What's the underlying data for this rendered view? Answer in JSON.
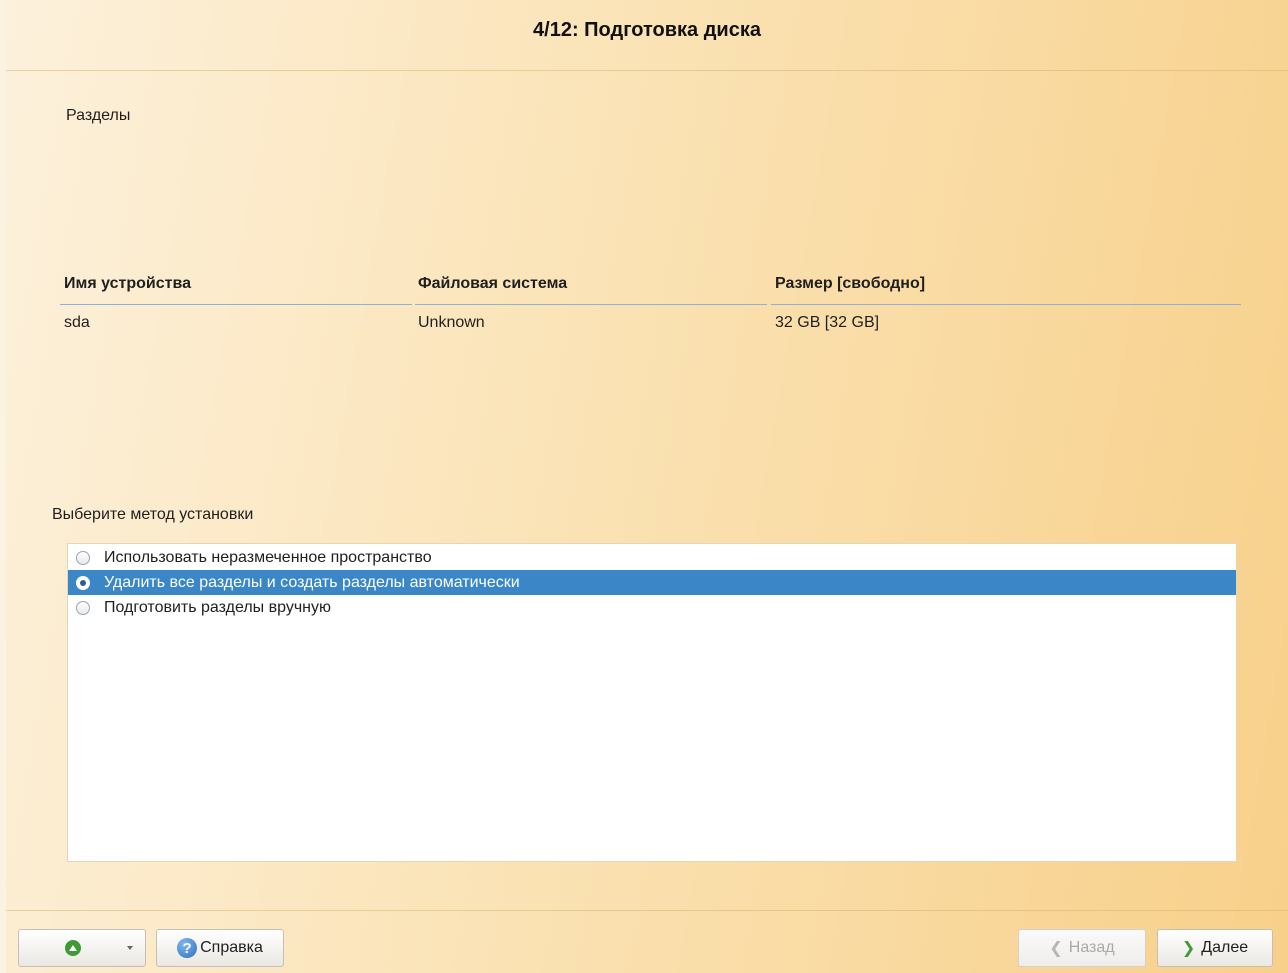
{
  "header": {
    "title": "4/12: Подготовка диска"
  },
  "partitions": {
    "label": "Разделы",
    "columns": [
      "Имя устройства",
      "Файловая система",
      "Размер [свободно]"
    ],
    "rows": [
      {
        "device": "sda",
        "filesystem": "Unknown",
        "size": "32 GB [32 GB]"
      }
    ]
  },
  "install_method": {
    "label": "Выберите метод установки",
    "selected_index": 1,
    "options": [
      "Использовать неразмеченное пространство",
      "Удалить все разделы и создать разделы автоматически",
      "Подготовить разделы вручную"
    ]
  },
  "footer": {
    "help_label": "Справка",
    "back_label": "Назад",
    "next_label": "Далее"
  },
  "icons": {
    "up": "up-arrow-circle-icon",
    "help": "help-icon",
    "back": "chevron-left-icon",
    "next": "chevron-right-icon"
  },
  "colors": {
    "selection": "#3a86c6",
    "header_line": "#8fb0d8"
  }
}
